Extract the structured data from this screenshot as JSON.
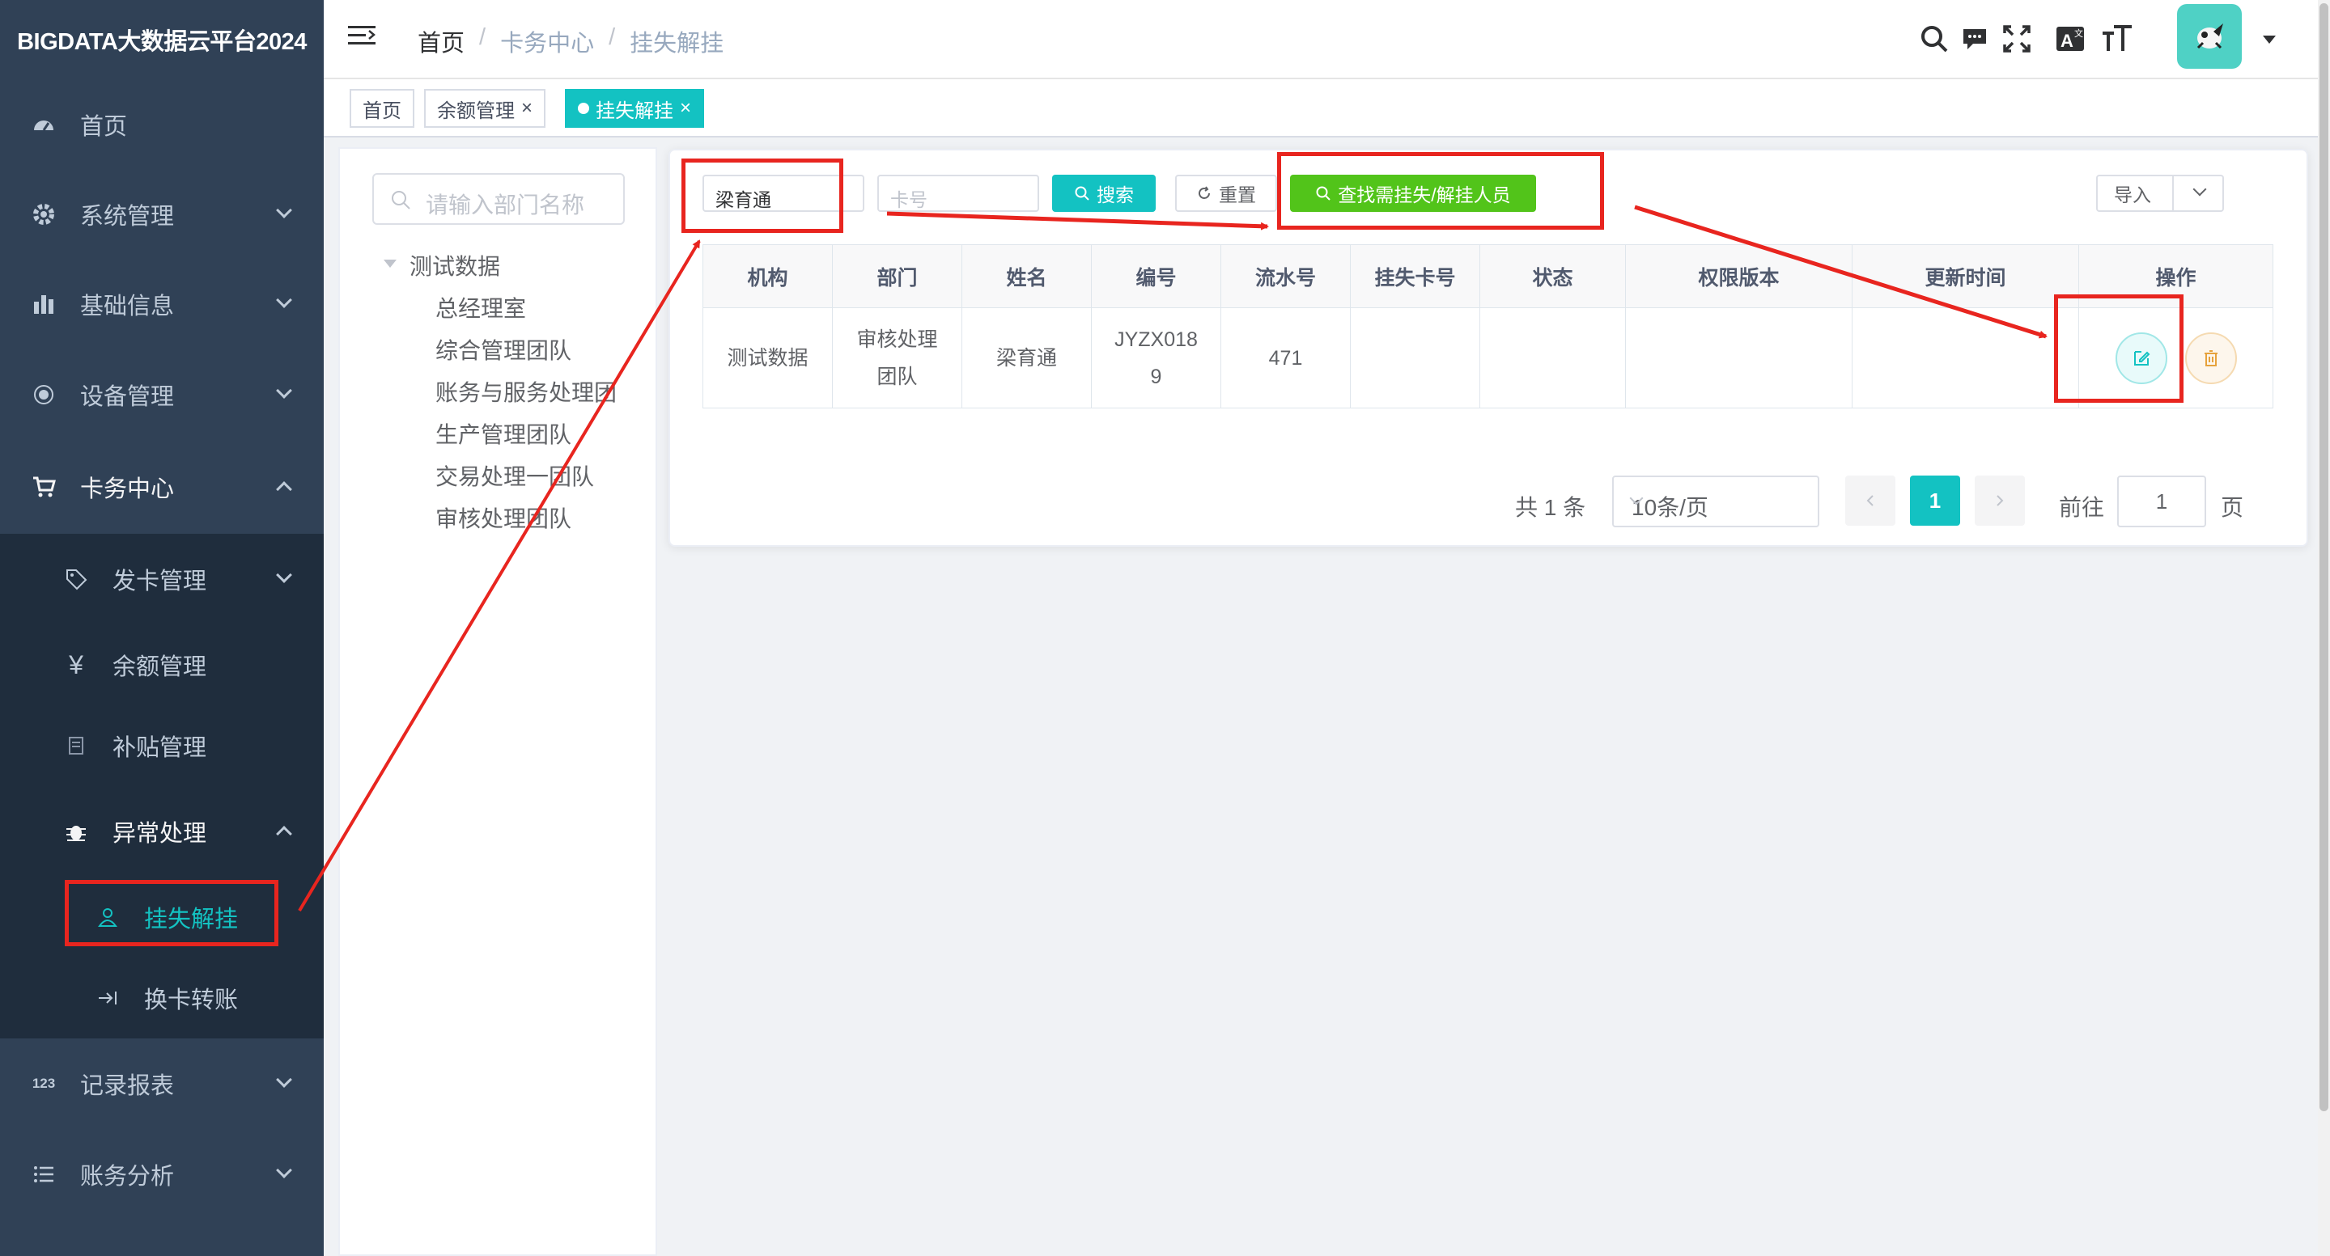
{
  "app_title": "BIGDATA大数据云平台2024",
  "sidebar": {
    "items": [
      {
        "label": "首页",
        "icon": "dashboard-icon"
      },
      {
        "label": "系统管理",
        "icon": "gear-icon"
      },
      {
        "label": "基础信息",
        "icon": "bar-chart-icon"
      },
      {
        "label": "设备管理",
        "icon": "radio-icon"
      },
      {
        "label": "卡务中心",
        "icon": "cart-icon"
      },
      {
        "label": "发卡管理",
        "icon": "tag-icon"
      },
      {
        "label": "余额管理",
        "icon": "yen-icon"
      },
      {
        "label": "补贴管理",
        "icon": "doc-icon"
      },
      {
        "label": "异常处理",
        "icon": "bug-icon"
      },
      {
        "label": "挂失解挂",
        "icon": "user-icon"
      },
      {
        "label": "换卡转账",
        "icon": "arrow-right-icon"
      },
      {
        "label": "记录报表",
        "icon": "number-icon"
      },
      {
        "label": "账务分析",
        "icon": "list-icon"
      }
    ]
  },
  "breadcrumb": [
    "首页",
    "卡务中心",
    "挂失解挂"
  ],
  "breadcrumb_sep": "/",
  "tags": [
    {
      "label": "首页"
    },
    {
      "label": "余额管理",
      "close": "×"
    },
    {
      "label": "挂失解挂",
      "close": "×"
    }
  ],
  "tree": {
    "search_placeholder": "请输入部门名称",
    "root": "测试数据",
    "children": [
      "总经理室",
      "综合管理团队",
      "账务与服务处理团",
      "生产管理团队",
      "交易处理一团队",
      "审核处理团队"
    ]
  },
  "search": {
    "name_value": "梁育通",
    "card_placeholder": "卡号",
    "search_label": "搜索",
    "reset_label": "重置",
    "find_label": "查找需挂失/解挂人员",
    "import_label": "导入"
  },
  "table": {
    "headers": [
      "机构",
      "部门",
      "姓名",
      "编号",
      "流水号",
      "挂失卡号",
      "状态",
      "权限版本",
      "更新时间",
      "操作"
    ],
    "rows": [
      {
        "org": "测试数据",
        "dept_1": "审核处理",
        "dept_2": "团队",
        "name": "梁育通",
        "code_1": "JYZX018",
        "code_2": "9",
        "serial": "471",
        "lost_card": "",
        "status": "",
        "perm_version": "",
        "updated": ""
      }
    ]
  },
  "pager": {
    "total": "共 1 条",
    "page_size": "10条/页",
    "current": "1",
    "goto_label": "前往",
    "goto_value": "1",
    "page_unit": "页"
  },
  "colors": {
    "sidebar_bg": "#304156",
    "submenu_bg": "#1f2d3d",
    "accent": "#13c2c2",
    "success": "#52c41a",
    "annotation_red": "#e8251f"
  }
}
